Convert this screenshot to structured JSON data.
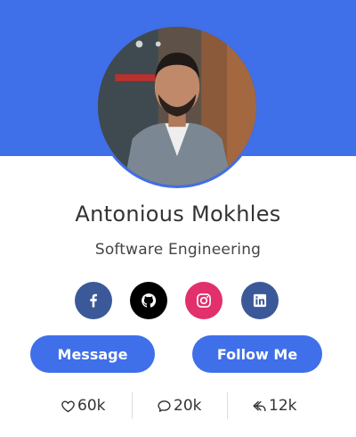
{
  "profile": {
    "name": "Antonious Mokhles",
    "role": "Software Engineering"
  },
  "socials": [
    {
      "icon": "facebook-icon",
      "color": "#3b5998"
    },
    {
      "icon": "github-icon",
      "color": "#000000"
    },
    {
      "icon": "instagram-icon",
      "color": "#e1306c"
    },
    {
      "icon": "linkedin-icon",
      "color": "#3b5998"
    }
  ],
  "buttons": {
    "message_label": "Message",
    "follow_label": "Follow Me"
  },
  "stats": {
    "likes": "60k",
    "comments": "20k",
    "shares": "12k"
  },
  "colors": {
    "accent": "#3f6fe9"
  }
}
